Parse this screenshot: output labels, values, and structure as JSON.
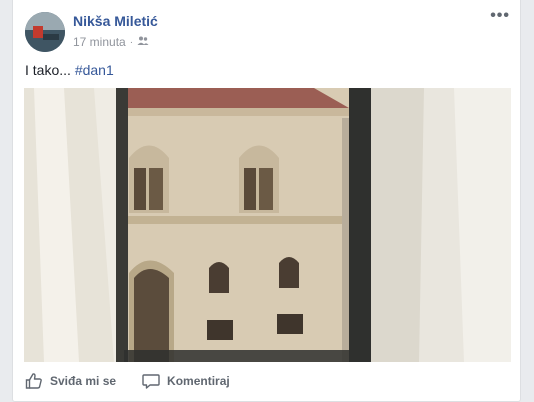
{
  "post": {
    "author_name": "Nikša Miletić",
    "timestamp": "17 minuta",
    "separator": "·",
    "audience_icon": "friends-icon",
    "text_prefix": "I tako... ",
    "hashtag": "#dan1",
    "more_icon": "more-options-icon",
    "more_label": "•••"
  },
  "actions": {
    "like_label": "Sviđa mi se",
    "like_icon": "thumbs-up-icon",
    "comment_label": "Komentiraj",
    "comment_icon": "comment-icon"
  },
  "colors": {
    "link": "#365899",
    "meta": "#90949c",
    "action": "#606770",
    "background": "#e9ebee"
  }
}
